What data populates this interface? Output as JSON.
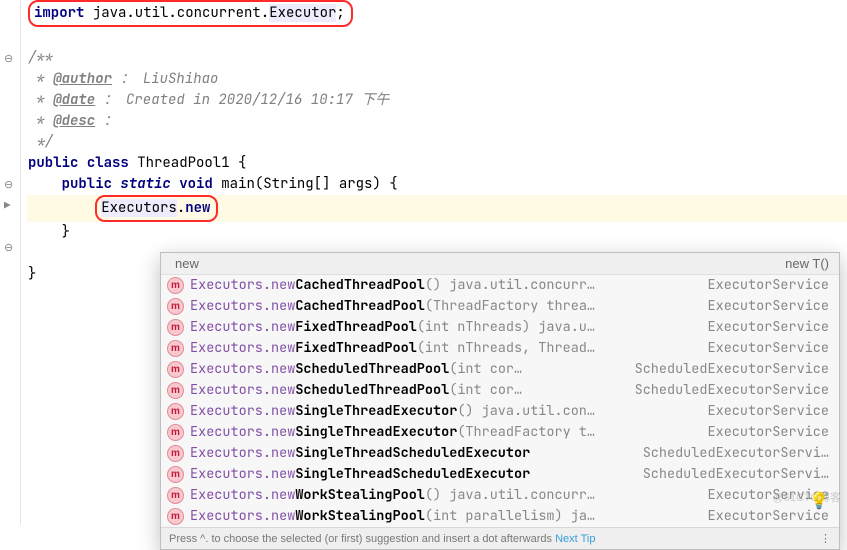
{
  "code": {
    "import_kw": "import",
    "import_path": " java.util.concurrent.",
    "import_class": "Executor",
    "import_semicolon": ";",
    "doc_open": "/**",
    "doc_author_star": " * ",
    "doc_author_tag": "@author",
    "doc_author_text": " ： LiuShihao",
    "doc_date_star": " * ",
    "doc_date_tag": "@date",
    "doc_date_text": " ： Created in 2020/12/16 10:17 下午",
    "doc_desc_star": " * ",
    "doc_desc_tag": "@desc",
    "doc_desc_text": " ：",
    "doc_close": " */",
    "public_kw": "public",
    "class_kw": "class",
    "class_name": " ThreadPool1 {",
    "main_public": "public",
    "main_static": "static",
    "main_void": "void",
    "main_sig": " main(String[] args) {",
    "exec_class": "Executors",
    "exec_dot": ".",
    "exec_new": "new",
    "brace1": "    }",
    "brace2": "}"
  },
  "popup": {
    "header_left": "new",
    "header_right": "new T()",
    "footer_text": "Press ^. to choose the selected (or first) suggestion and insert a dot afterwards",
    "footer_link": "Next Tip",
    "footer_menu": "⋮"
  },
  "suggestions": [
    {
      "prefix": "Executors.new",
      "bold": "CachedThreadPool",
      "tail": "() java.util.concurr…",
      "ret": "ExecutorService"
    },
    {
      "prefix": "Executors.new",
      "bold": "CachedThreadPool",
      "tail": "(ThreadFactory threa…",
      "ret": "ExecutorService"
    },
    {
      "prefix": "Executors.new",
      "bold": "FixedThreadPool",
      "tail": "(int nThreads) java.u…",
      "ret": "ExecutorService"
    },
    {
      "prefix": "Executors.new",
      "bold": "FixedThreadPool",
      "tail": "(int nThreads, Thread…",
      "ret": "ExecutorService"
    },
    {
      "prefix": "Executors.new",
      "bold": "ScheduledThreadPool",
      "tail": "(int cor…",
      "ret": "ScheduledExecutorService"
    },
    {
      "prefix": "Executors.new",
      "bold": "ScheduledThreadPool",
      "tail": "(int cor…",
      "ret": "ScheduledExecutorService"
    },
    {
      "prefix": "Executors.new",
      "bold": "SingleThreadExecutor",
      "tail": "() java.util.con…",
      "ret": "ExecutorService"
    },
    {
      "prefix": "Executors.new",
      "bold": "SingleThreadExecutor",
      "tail": "(ThreadFactory t…",
      "ret": "ExecutorService"
    },
    {
      "prefix": "Executors.new",
      "bold": "SingleThreadScheduledExecutor",
      "tail": "",
      "ret": "ScheduledExecutorServi…"
    },
    {
      "prefix": "Executors.new",
      "bold": "SingleThreadScheduledExecutor",
      "tail": "",
      "ret": "ScheduledExecutorServi…"
    },
    {
      "prefix": "Executors.new",
      "bold": "WorkStealingPool",
      "tail": "() java.util.concurr…",
      "ret": "ExecutorService"
    },
    {
      "prefix": "Executors.new",
      "bold": "WorkStealingPool",
      "tail": "(int parallelism) ja…",
      "ret": "ExecutorService"
    }
  ],
  "watermark": "@51CTO博客"
}
